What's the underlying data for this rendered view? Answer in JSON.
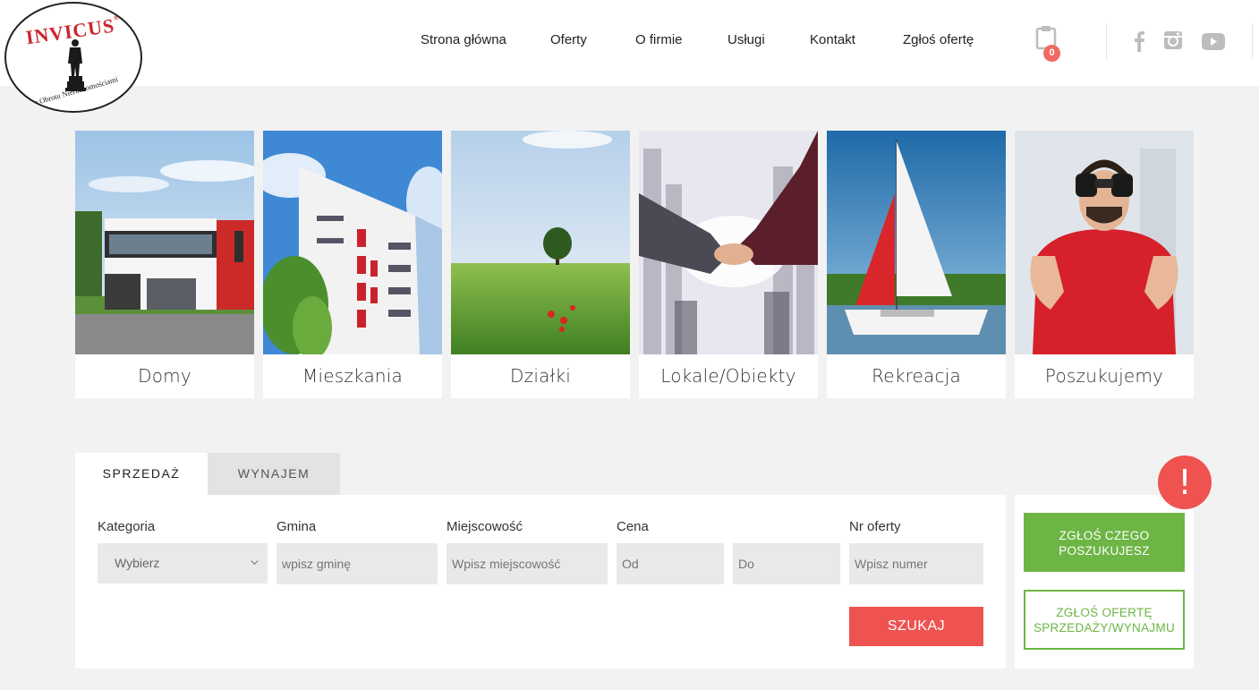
{
  "logo": {
    "brand": "INVICUS",
    "registered": "®",
    "subtitle": "Biuro Obrotu Nieruchomościami"
  },
  "nav": {
    "items": [
      {
        "label": "Strona główna"
      },
      {
        "label": "Oferty"
      },
      {
        "label": "O firmie"
      },
      {
        "label": "Usługi"
      },
      {
        "label": "Kontakt"
      },
      {
        "label": "Zgłoś ofertę"
      }
    ]
  },
  "cart": {
    "icon": "clipboard-icon",
    "count": "0"
  },
  "social": [
    {
      "icon": "facebook-icon"
    },
    {
      "icon": "instagram-icon"
    },
    {
      "icon": "youtube-icon"
    }
  ],
  "categories": [
    {
      "label": "Domy",
      "image": "modern-house"
    },
    {
      "label": "Mieszkania",
      "image": "apartment-building"
    },
    {
      "label": "Działki",
      "image": "green-field-tree"
    },
    {
      "label": "Lokale/Obiekty",
      "image": "business-handshake"
    },
    {
      "label": "Rekreacja",
      "image": "sailboat"
    },
    {
      "label": "Poszukujemy",
      "image": "man-with-binoculars"
    }
  ],
  "search": {
    "tabs": [
      {
        "label": "SPRZEDAŻ",
        "active": true
      },
      {
        "label": "WYNAJEM",
        "active": false
      }
    ],
    "fields": {
      "kategoria": {
        "label": "Kategoria",
        "value": "Wybierz"
      },
      "gmina": {
        "label": "Gmina",
        "placeholder": "wpisz gminę"
      },
      "miejscowosc": {
        "label": "Miejscowość",
        "placeholder": "Wpisz miejscowość"
      },
      "cena": {
        "label": "Cena",
        "from_placeholder": "Od",
        "to_placeholder": "Do"
      },
      "nr_oferty": {
        "label": "Nr oferty",
        "placeholder": "Wpisz numer"
      }
    },
    "submit_label": "SZUKAJ"
  },
  "side": {
    "alert_symbol": "!",
    "primary_line1": "ZGŁOŚ CZEGO",
    "primary_line2": "POSZUKUJESZ",
    "secondary_line1": "ZGŁOŚ OFERTĘ",
    "secondary_line2": "SPRZEDAŻY/WYNAJMU"
  },
  "colors": {
    "accent_red": "#ef5350",
    "accent_green": "#6db545",
    "brand_red": "#c9262f",
    "background": "#f2f2f2"
  }
}
